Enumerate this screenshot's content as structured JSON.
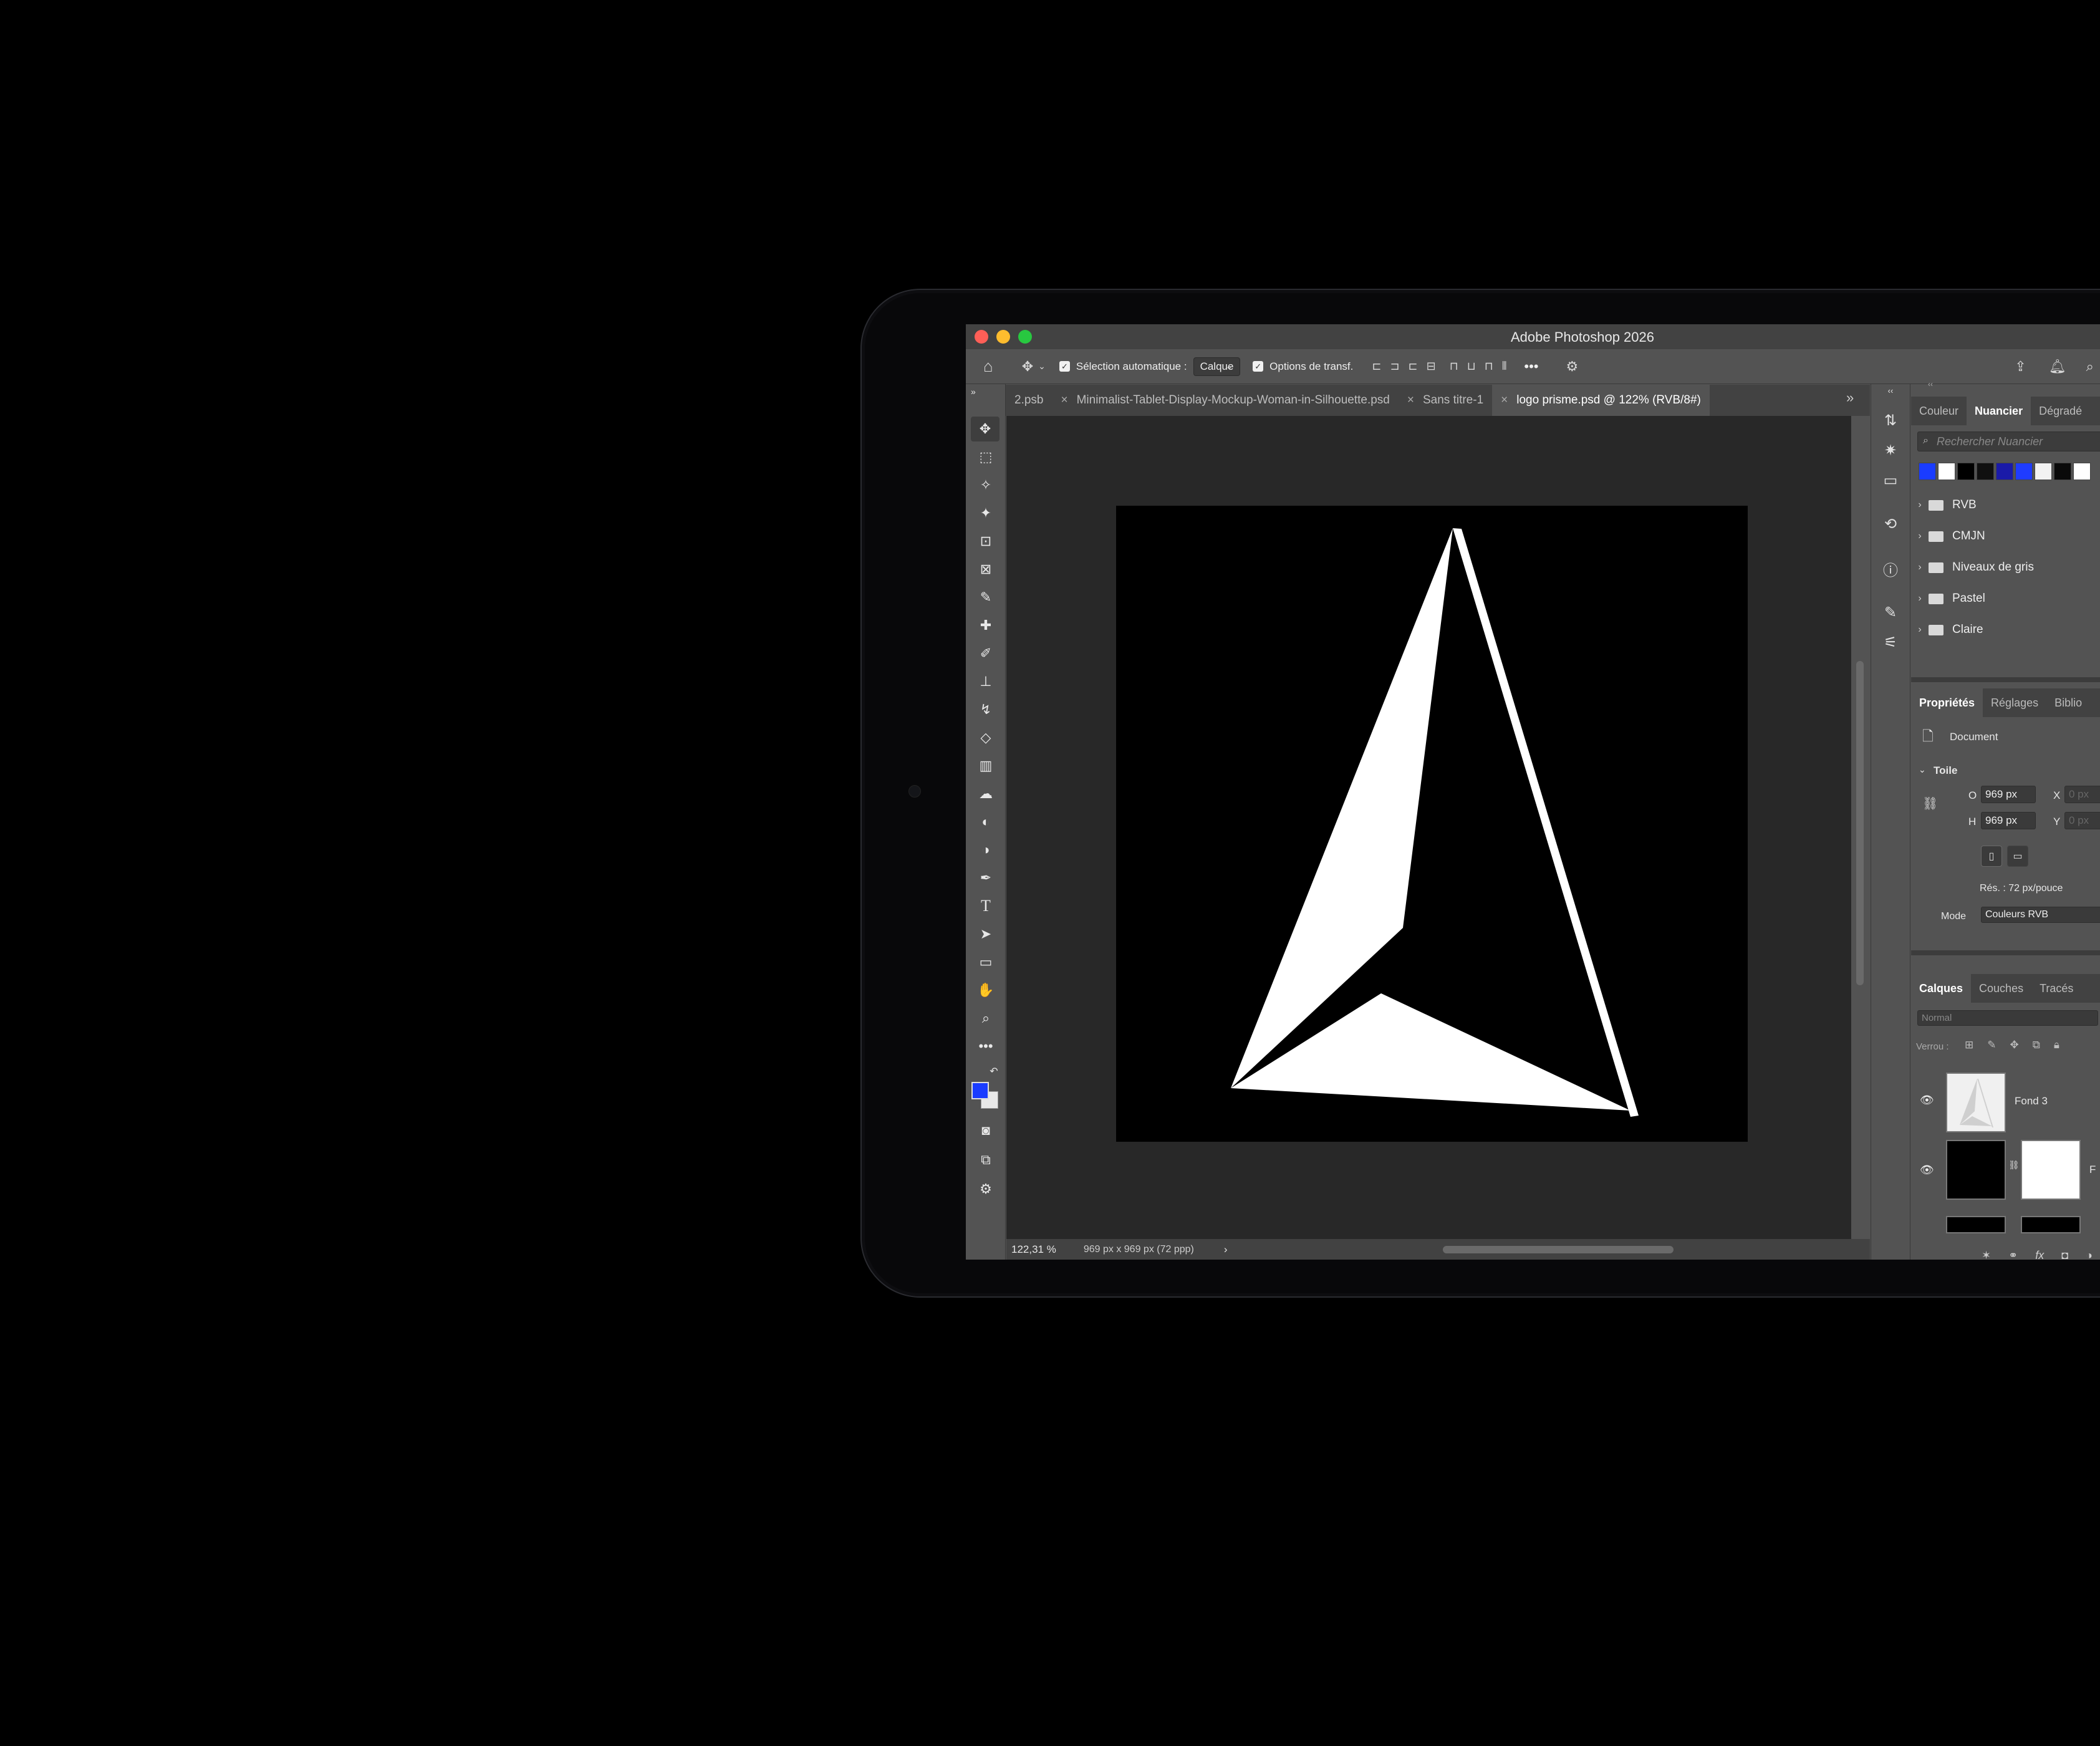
{
  "app": {
    "title": "Adobe Photoshop 2026",
    "colors": {
      "traffic_red": "#ff5f57",
      "traffic_yellow": "#febc2e",
      "traffic_green": "#28c840",
      "foreground": "#1a3cff",
      "background": "#e8e8e8"
    }
  },
  "options": {
    "home_icon": "home-icon",
    "move_icon": "move-icon",
    "auto_select_label": "Sélection automatique :",
    "auto_select_value": "Calque",
    "transform_label": "Options de transf.",
    "more_label": "•••",
    "gear_icon": "gear-icon",
    "share_icon": "share-icon",
    "bell_icon": "bell-icon",
    "search_icon": "search-icon"
  },
  "tabs": [
    {
      "label": "2.psb",
      "active": false
    },
    {
      "label": "Minimalist-Tablet-Display-Mockup-Woman-in-Silhouette.psd",
      "active": false
    },
    {
      "label": "Sans titre-1",
      "active": false
    },
    {
      "label": "logo prisme.psd @ 122% (RVB/8#)",
      "active": true
    }
  ],
  "tabs_more": "»",
  "close_glyph": "×",
  "tools": {
    "move": "✥",
    "marquee": "⬚",
    "lasso": "✧",
    "wand": "✦",
    "crop": "⊡",
    "frame": "⊠",
    "eyedropper": "✎",
    "heal": "✚",
    "brush": "✐",
    "stamp": "⊥",
    "history_brush": "↯",
    "eraser": "◇",
    "gradient": "▥",
    "smudge": "☁",
    "dodge": "◐",
    "burn": "◑",
    "pen": "✒",
    "type": "T",
    "path_select": "➤",
    "rect": "▭",
    "hand": "✋",
    "zoom": "⌕",
    "more": "•••",
    "reset": "↶",
    "mask": "◙",
    "screen_mode": "⧉",
    "extras": "⚙"
  },
  "panel_icons": {
    "adjust": "⇅",
    "magic": "✷",
    "comment": "▭",
    "history": "⟲",
    "info": "ⓘ",
    "brushes": "✎",
    "sliders": "⚟"
  },
  "status": {
    "zoom": "122,31 %",
    "doc_info": "969 px x 969 px (72 ppp)",
    "arrow": "›"
  },
  "swatches_panel": {
    "tabs": [
      "Couleur",
      "Nuancier",
      "Dégradé"
    ],
    "active_tab": "Nuancier",
    "search_placeholder": "Rechercher Nuancier",
    "swatch_colors": [
      "#1a3cff",
      "#ffffff",
      "#000000",
      "#101010",
      "#1a1aa8",
      "#1f3cff",
      "#f2f2f2",
      "#0a0a0a",
      "#ffffff"
    ],
    "groups": [
      "RVB",
      "CMJN",
      "Niveaux de gris",
      "Pastel",
      "Claire"
    ]
  },
  "properties": {
    "tabs": [
      "Propriétés",
      "Réglages",
      "Biblio"
    ],
    "document_label": "Document",
    "section_title": "Toile",
    "w_label": "O",
    "w_value": "969 px",
    "h_label": "H",
    "h_value": "969 px",
    "x_label": "X",
    "x_value": "0 px",
    "y_label": "Y",
    "y_value": "0 px",
    "resolution": "Rés. : 72 px/pouce",
    "mode_label": "Mode",
    "mode_value": "Couleurs RVB"
  },
  "layers": {
    "tabs": [
      "Calques",
      "Couches",
      "Tracés"
    ],
    "blend_mode": "Normal",
    "lock_label": "Verrou :",
    "items": [
      {
        "name": "Fond 3"
      },
      {
        "name": "F"
      }
    ]
  }
}
